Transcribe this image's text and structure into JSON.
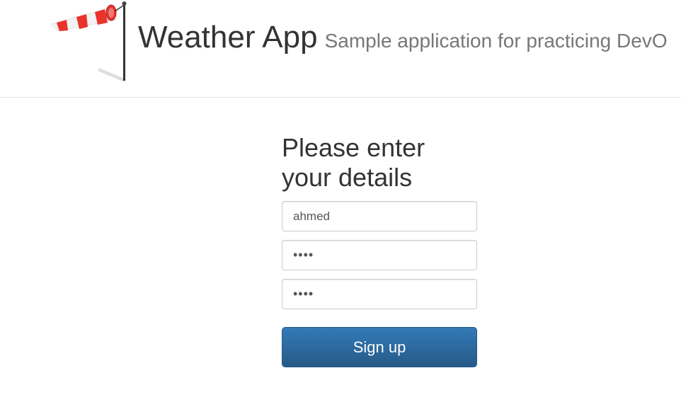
{
  "header": {
    "title": "Weather App",
    "subtitle": "Sample application for practicing DevO"
  },
  "logo": {
    "icon": "windsock-icon",
    "colors": {
      "stripe_red": "#e8332a",
      "stripe_white": "#f2f2f2",
      "pole": "#333333"
    }
  },
  "form": {
    "heading_line1": "Please enter",
    "heading_line2": "your details",
    "username_value": "ahmed",
    "password_value": "••••",
    "confirm_password_value": "••••",
    "submit_label": "Sign up"
  },
  "colors": {
    "accent": "#337ab7",
    "accent_dark": "#265a88"
  }
}
